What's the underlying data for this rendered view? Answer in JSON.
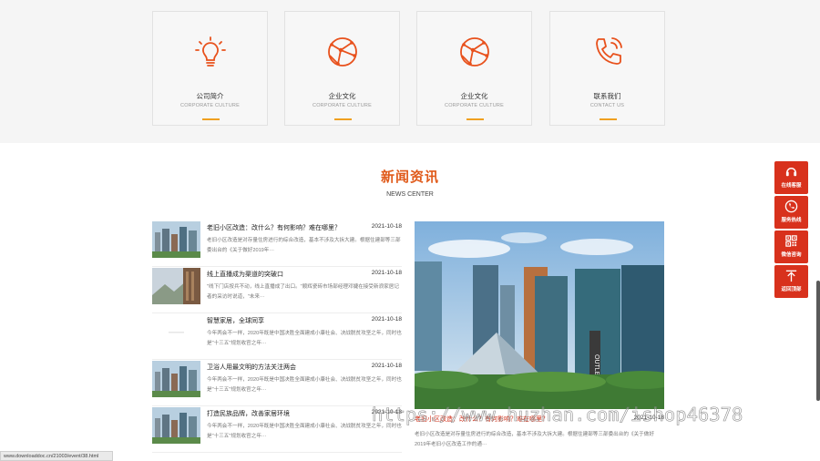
{
  "cards": [
    {
      "title": "公司简介",
      "subtitle": "CORPORATE CULTURE",
      "icon": "lightbulb-icon"
    },
    {
      "title": "企业文化",
      "subtitle": "CORPORATE CULTURE",
      "icon": "globe-network-icon"
    },
    {
      "title": "企业文化",
      "subtitle": "CORPORATE CULTURE",
      "icon": "globe-network-icon"
    },
    {
      "title": "联系我们",
      "subtitle": "CONTACT US",
      "icon": "phone-icon"
    }
  ],
  "news": {
    "title": "新闻资讯",
    "subtitle": "NEWS CENTER",
    "items": [
      {
        "title": "老旧小区改造：改什么？有何影响？难在哪里？",
        "date": "2021-10-18",
        "desc": "老旧小区改造是对存量住房进行的综合改造，基本不涉及大拆大建。根据住建部等三部委出台的《关于做好2019年···"
      },
      {
        "title": "线上直播成为渠道的突破口",
        "date": "2021-10-18",
        "desc": "\"线下门店按兵不动，线上直播成了出口。\"顺辉瓷砖市场部经理邓婕在接受新浪家居记者的采访时说道，\"未来···"
      },
      {
        "title": "智慧家居，全球同享",
        "date": "2021-10-18",
        "desc": "今年两会不一样，2020年既是中国决胜全面建成小康社会、决战脱贫攻坚之年，同时也是\"十三五\"规划收官之年···"
      },
      {
        "title": "卫浴人用最文明的方法关注两会",
        "date": "2021-10-18",
        "desc": "今年两会不一样，2020年既是中国决胜全面建成小康社会、决战脱贫攻坚之年，同时也是\"十三五\"规划收官之年···"
      },
      {
        "title": "打造民族品牌，改善家居环境",
        "date": "2021-10-18",
        "desc": "今年两会不一样，2020年既是中国决胜全面建成小康社会、决战脱贫攻坚之年，同时也是\"十三五\"规划收官之年···"
      }
    ],
    "feature": {
      "title": "老旧小区改造：改什么？有何影响？难在哪里？",
      "date": "2021-10-18",
      "desc": "老旧小区改造是对存量住房进行的综合改造，基本不涉及大拆大建。根据住建部等三部委出台的《关于做好2019年老旧小区改造工作的通···",
      "sign_text": "OUTLET"
    }
  },
  "sidebar": [
    {
      "label": "在线客服",
      "icon": "headset-icon"
    },
    {
      "label": "服务热线",
      "icon": "phone-call-icon"
    },
    {
      "label": "微信咨询",
      "icon": "qrcode-icon"
    },
    {
      "label": "返回顶部",
      "icon": "arrow-up-icon"
    }
  ],
  "status_url": "www.downloaddoc.cn/21003/event/38.html",
  "watermark": "https://www.huzhan.com/ishop46378",
  "colors": {
    "accent": "#e05a1a",
    "side": "#d8311c",
    "underline": "#f0a020"
  }
}
